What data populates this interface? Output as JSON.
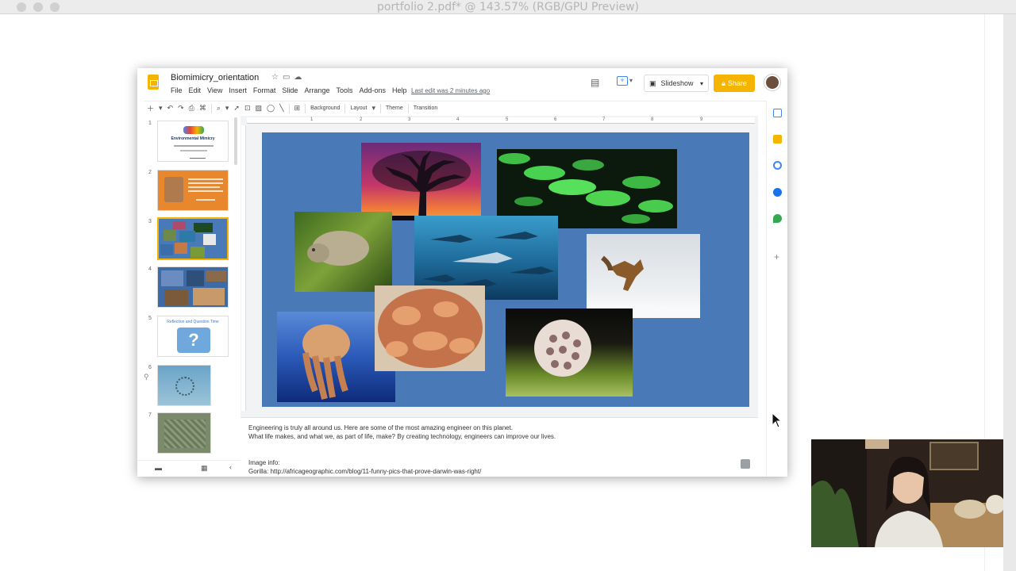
{
  "preview_window": {
    "title": "portfolio 2.pdf* @ 143.57% (RGB/GPU Preview)"
  },
  "slides_app": {
    "doc_title": "Biomimicry_orientation",
    "menu": [
      "File",
      "Edit",
      "View",
      "Insert",
      "Format",
      "Slide",
      "Arrange",
      "Tools",
      "Add-ons",
      "Help"
    ],
    "last_edit": "Last edit was 2 minutes ago",
    "slideshow_label": "Slideshow",
    "share_label": "Share",
    "toolbar": {
      "background_label": "Background",
      "layout_label": "Layout",
      "theme_label": "Theme",
      "transition_label": "Transition"
    },
    "ruler_ticks": [
      "1",
      "2",
      "3",
      "4",
      "5",
      "6",
      "7",
      "8",
      "9"
    ],
    "filmstrip": {
      "numbers": [
        "1",
        "2",
        "3",
        "4",
        "5",
        "6",
        "7"
      ],
      "slide1_title": "Environmental Mimicry",
      "slide5_title": "Reflection and Question Time",
      "slide5_mark": "?"
    },
    "notes": {
      "line1": "Engineering is truly all around us. Here are some of the most amazing engineer on this planet.",
      "line2": "What life makes, and what we, as part of life, make? By creating technology, engineers can improve our lives.",
      "line3": "Image info:",
      "line4": "Gorilla: http://africageographic.com/blog/11-funny-pics-that-prove-darwin-was-right/"
    }
  },
  "colors": {
    "slide_bg": "#4a79b7",
    "share": "#f4b400",
    "thumb_selected": "#f4b400"
  }
}
